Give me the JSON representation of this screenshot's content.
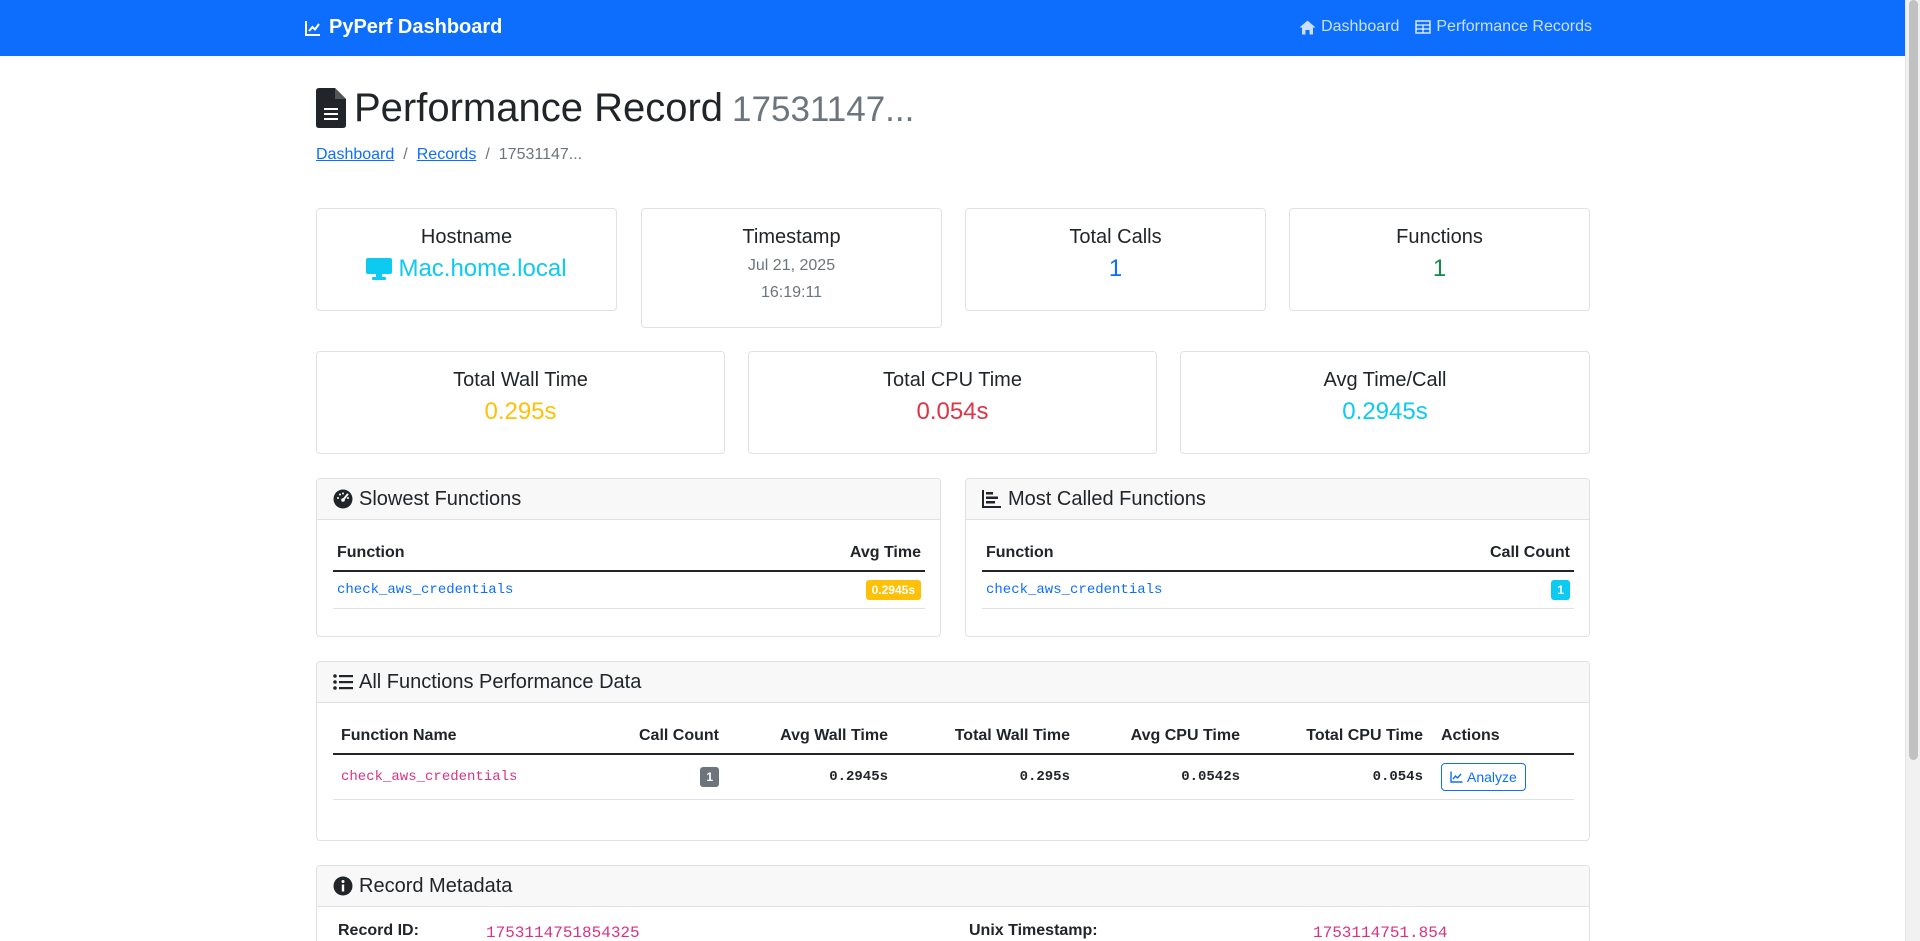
{
  "nav": {
    "brand": "PyPerf Dashboard",
    "links": [
      "Dashboard",
      "Performance Records"
    ]
  },
  "page": {
    "title": "Performance Record",
    "subtitle": "17531147...",
    "breadcrumb": [
      "Dashboard",
      "Records",
      "17531147..."
    ]
  },
  "stats": {
    "hostname": {
      "label": "Hostname",
      "value": "Mac.home.local"
    },
    "timestamp": {
      "label": "Timestamp",
      "date": "Jul 21, 2025",
      "time": "16:19:11"
    },
    "total_calls": {
      "label": "Total Calls",
      "value": "1"
    },
    "functions": {
      "label": "Functions",
      "value": "1"
    },
    "total_wall_time": {
      "label": "Total Wall Time",
      "value": "0.295s"
    },
    "total_cpu_time": {
      "label": "Total CPU Time",
      "value": "0.054s"
    },
    "avg_time_call": {
      "label": "Avg Time/Call",
      "value": "0.2945s"
    }
  },
  "slowest": {
    "title": "Slowest Functions",
    "headers": [
      "Function",
      "Avg Time"
    ],
    "rows": [
      {
        "function": "check_aws_credentials",
        "value": "0.2945s"
      }
    ]
  },
  "most_called": {
    "title": "Most Called Functions",
    "headers": [
      "Function",
      "Call Count"
    ],
    "rows": [
      {
        "function": "check_aws_credentials",
        "value": "1"
      }
    ]
  },
  "all_functions": {
    "title": "All Functions Performance Data",
    "headers": [
      "Function Name",
      "Call Count",
      "Avg Wall Time",
      "Total Wall Time",
      "Avg CPU Time",
      "Total CPU Time",
      "Actions"
    ],
    "rows": [
      {
        "name": "check_aws_credentials",
        "calls": "1",
        "avg_wall": "0.2945s",
        "total_wall": "0.295s",
        "avg_cpu": "0.0542s",
        "total_cpu": "0.054s",
        "action": "Analyze"
      }
    ]
  },
  "metadata": {
    "title": "Record Metadata",
    "record_id_label": "Record ID:",
    "record_id": "1753114751854325",
    "unix_ts_label": "Unix Timestamp:",
    "unix_ts": "1753114751.854"
  },
  "colors": {
    "primary": "#0d6efd",
    "success": "#198754",
    "warning": "#ffc107",
    "danger": "#dc3545",
    "info": "#0dcaf0"
  }
}
